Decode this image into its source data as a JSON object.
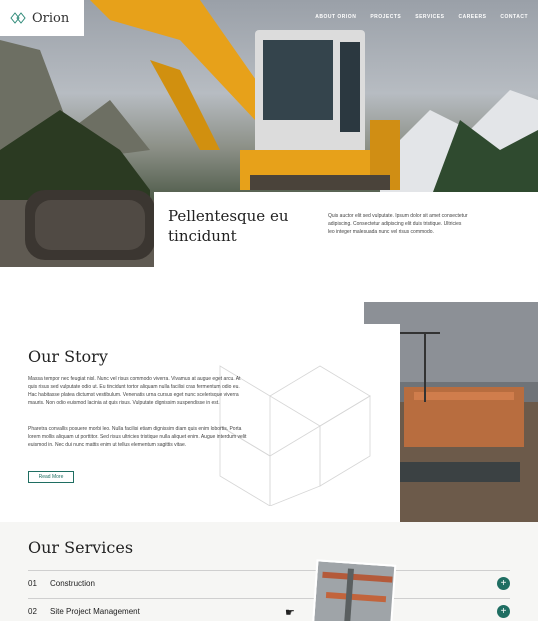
{
  "header": {
    "logo_text": "Orion",
    "nav": [
      "ABOUT ORION",
      "PROJECTS",
      "SERVICES",
      "CAREERS",
      "CONTACT"
    ]
  },
  "hero": {
    "title": "Pellentesque eu tincidunt",
    "text": "Quis auctor elit sed vulputate. Ipsum dolor sit amet consectetur adipiscing. Consectetur adipiscing elit duis tristique. Ultricies leo integer malesuada nunc vel risus commodo."
  },
  "story": {
    "title": "Our Story",
    "p1": "Massa tempor nec feugiat nisl. Nunc vel risus commodo viverra. Vivamus at augue eget arcu. At quis risus sed vulputate odio ut. Eu tincidunt tortor aliquam nulla facilisi cras fermentum odio eu. Hac habitasse platea dictumst vestibulum. Venenatis urna cursus eget nunc scelerisque viverra mauris. Non odio euismod lacinia at quis risus. Vulputate dignissim suspendisse in est.",
    "p2": "Pharetra convallis posuere morbi leo. Nulla facilisi etiam dignissim diam quis enim lobortis. Porta lorem mollis aliquam ut porttitor. Sed risus ultricies tristique nulla aliquet enim. Augue interdum velit euismod in. Nec dui nunc mattis enim ut tellus elementum sagittis vitae.",
    "button": "Read More"
  },
  "services": {
    "title": "Our Services",
    "items": [
      {
        "num": "01",
        "label": "Construction"
      },
      {
        "num": "02",
        "label": "Site Project Management"
      }
    ]
  },
  "colors": {
    "accent": "#1f6e62"
  }
}
